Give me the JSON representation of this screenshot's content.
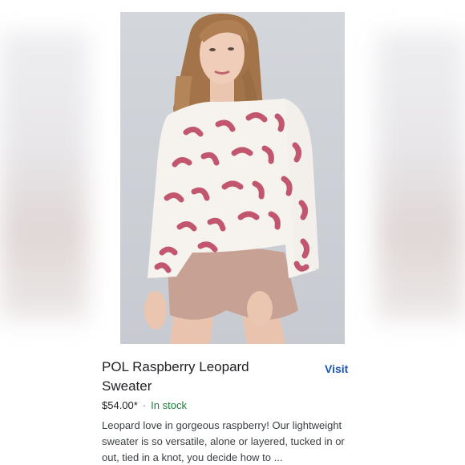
{
  "product": {
    "title": "POL Raspberry Leopard Sweater",
    "visit_label": "Visit",
    "price": "$54.00*",
    "separator": "·",
    "stock_status": "In stock",
    "description": "Leopard love in gorgeous raspberry! Our lightweight sweater is so versatile, alone or layered, tucked in or out, tied in a knot, you decide how to ..."
  },
  "colors": {
    "accent_link": "#1a56b8",
    "stock_green": "#188038",
    "title_text": "#202124",
    "body_text": "#3c4043",
    "leopard_spot": "#c2566e",
    "sweater": "#f6f3ef"
  },
  "icons": {
    "image": "product-photo"
  }
}
